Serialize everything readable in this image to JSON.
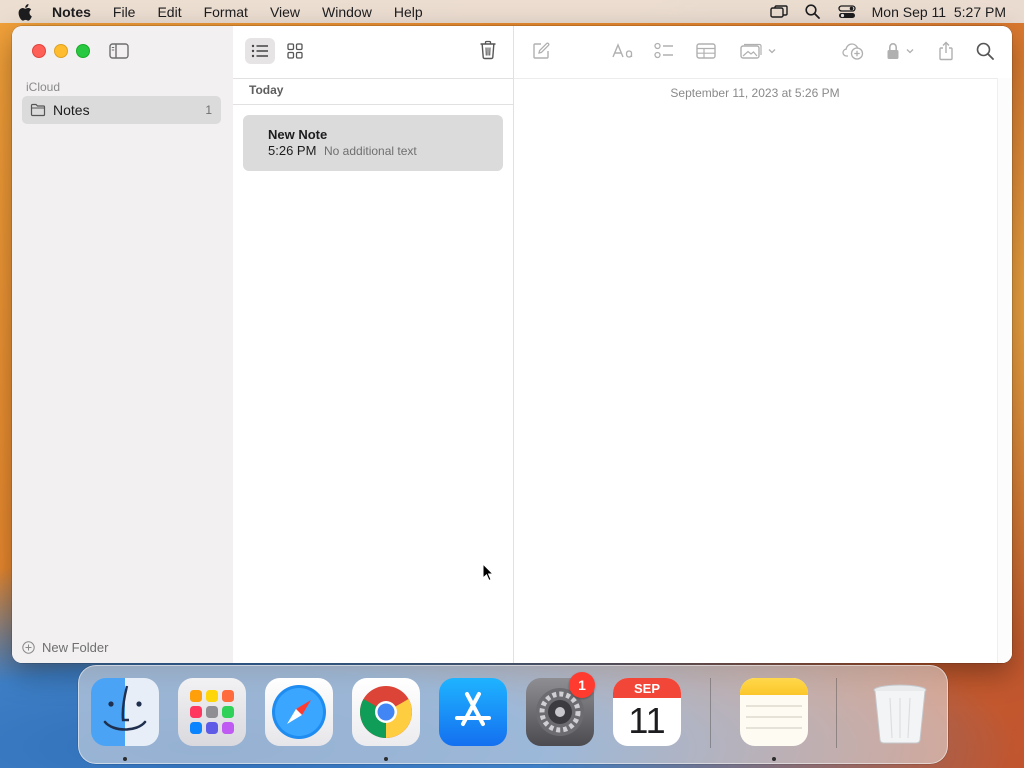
{
  "menubar": {
    "app_name": "Notes",
    "menus": [
      "File",
      "Edit",
      "Format",
      "View",
      "Window",
      "Help"
    ],
    "clock": "Mon Sep 11  5:27 PM"
  },
  "sidebar": {
    "section": "iCloud",
    "folders": [
      {
        "label": "Notes",
        "count": "1"
      }
    ],
    "new_folder_label": "New Folder"
  },
  "list": {
    "section_label": "Today",
    "notes": [
      {
        "title": "New Note",
        "time": "5:26 PM",
        "preview": "No additional text"
      }
    ]
  },
  "editor": {
    "date_label": "September 11, 2023 at 5:26 PM"
  },
  "dock": {
    "apps": [
      "Finder",
      "Launchpad",
      "Safari",
      "Google Chrome",
      "App Store",
      "System Settings",
      "Calendar",
      "Notes",
      "Trash"
    ],
    "calendar_month": "SEP",
    "calendar_day": "11",
    "settings_badge": "1"
  },
  "colors": {
    "accent": "#febc2e",
    "close": "#fe5f57",
    "minimize": "#febc2e",
    "zoom": "#28c840",
    "badge": "#ff3b30"
  }
}
